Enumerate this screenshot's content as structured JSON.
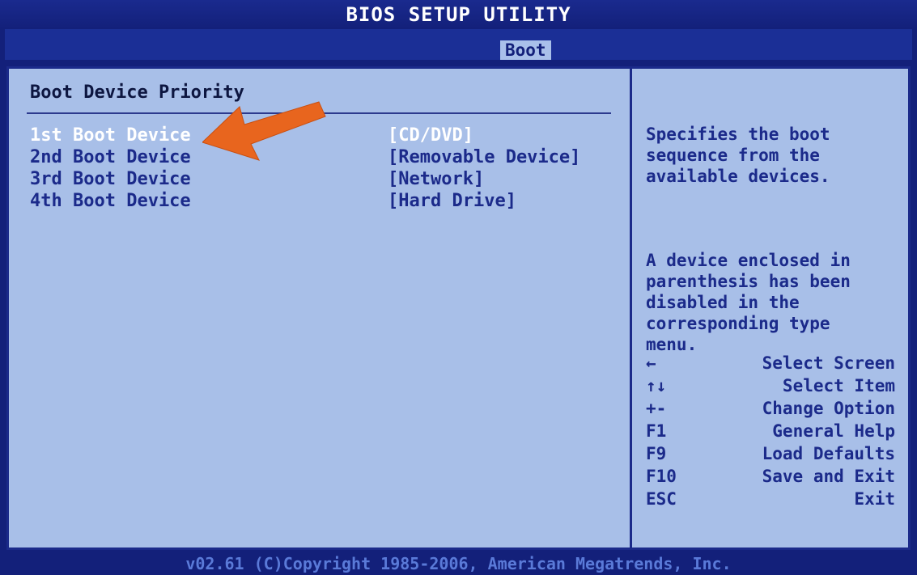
{
  "header": {
    "title": "BIOS SETUP UTILITY",
    "active_tab": "Boot"
  },
  "section": {
    "title": "Boot Device Priority"
  },
  "boot_devices": [
    {
      "label": "1st Boot Device",
      "value": "[CD/DVD]"
    },
    {
      "label": "2nd Boot Device",
      "value": "[Removable Device]"
    },
    {
      "label": "3rd Boot Device",
      "value": "[Network]"
    },
    {
      "label": "4th Boot Device",
      "value": "[Hard Drive]"
    }
  ],
  "help": {
    "paragraph1": "Specifies the boot\nsequence from the\navailable devices.",
    "paragraph2": "A device enclosed in\nparenthesis has been\ndisabled in the\ncorresponding type\nmenu."
  },
  "keys": [
    {
      "key": "←",
      "desc": "Select Screen"
    },
    {
      "key": "↑↓",
      "desc": "Select Item"
    },
    {
      "key": "+-",
      "desc": "Change Option"
    },
    {
      "key": "F1",
      "desc": "General Help"
    },
    {
      "key": "F9",
      "desc": "Load Defaults"
    },
    {
      "key": "F10",
      "desc": "Save and Exit"
    },
    {
      "key": "ESC",
      "desc": "Exit"
    }
  ],
  "footer": {
    "copyright": "v02.61 (C)Copyright 1985-2006, American Megatrends, Inc."
  },
  "colors": {
    "background": "#13207a",
    "panel": "#a8bfe8",
    "text": "#1b2a8a",
    "selected": "#ffffff",
    "arrow": "#e8651e"
  },
  "icons": {
    "pointer": "orange-arrow-icon"
  }
}
